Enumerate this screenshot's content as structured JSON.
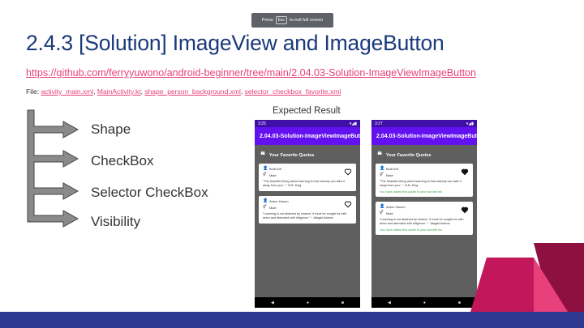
{
  "fullscreen_hint": {
    "prefix": "Press",
    "key": "Esc",
    "suffix": "to exit full screen"
  },
  "slide": {
    "title": "2.4.3 [Solution] ImageView and ImageButton",
    "repo_link": "https://github.com/ferryyuwono/android-beginner/tree/main/2.04.03-Solution-ImageViewImageButton",
    "files_label": "File:",
    "files": [
      "activity_main.xml",
      "MainActivity.kt",
      "shape_person_background.xml",
      "selector_checkbox_favorite.xml"
    ],
    "items": [
      "Shape",
      "CheckBox",
      "Selector CheckBox",
      "Visibility"
    ],
    "expected_label": "Expected Result"
  },
  "phones": [
    {
      "time": "3:25",
      "app_title": "2.04.03-Solution-ImageViewImageBut...",
      "section_title": "Your Favorite Quotes",
      "cards": [
        {
          "name": "Budi Arif",
          "gender": "Male",
          "quote": "\"The beautiful thing about learning is that nobody can take it away from you.\" ~ B.B. King",
          "favorite": false,
          "added": ""
        },
        {
          "name": "Anton Harum",
          "gender": "Male",
          "quote": "\"Learning is not attained by chance, it must be sought for with ardor and attended with diligence.\" ~ Abigail Adams",
          "favorite": false,
          "added": ""
        }
      ]
    },
    {
      "time": "3:27",
      "app_title": "2.04.03-Solution-ImageViewImageBut...",
      "section_title": "Your Favorite Quotes",
      "cards": [
        {
          "name": "Budi Arif",
          "gender": "Male",
          "quote": "\"The beautiful thing about learning is that nobody can take it away from you.\" ~ B.B. King",
          "favorite": true,
          "added": "You have added this quote to your favorite list"
        },
        {
          "name": "Anton Harum",
          "gender": "Male",
          "quote": "\"Learning is not attained by chance, it must be sought for with ardor and attended with diligence.\" ~ Abigail Adams",
          "favorite": true,
          "added": "You have added this quote to your favorite list"
        }
      ]
    }
  ],
  "colors": {
    "title": "#1a3a7a",
    "link": "#e8407a",
    "statusbar": "#3f0fa8",
    "appbar": "#6311ee",
    "band": "#2e3a8f",
    "deco_pink": "#e8407a",
    "deco_red": "#c2185b",
    "deco_dark": "#8e1040"
  }
}
